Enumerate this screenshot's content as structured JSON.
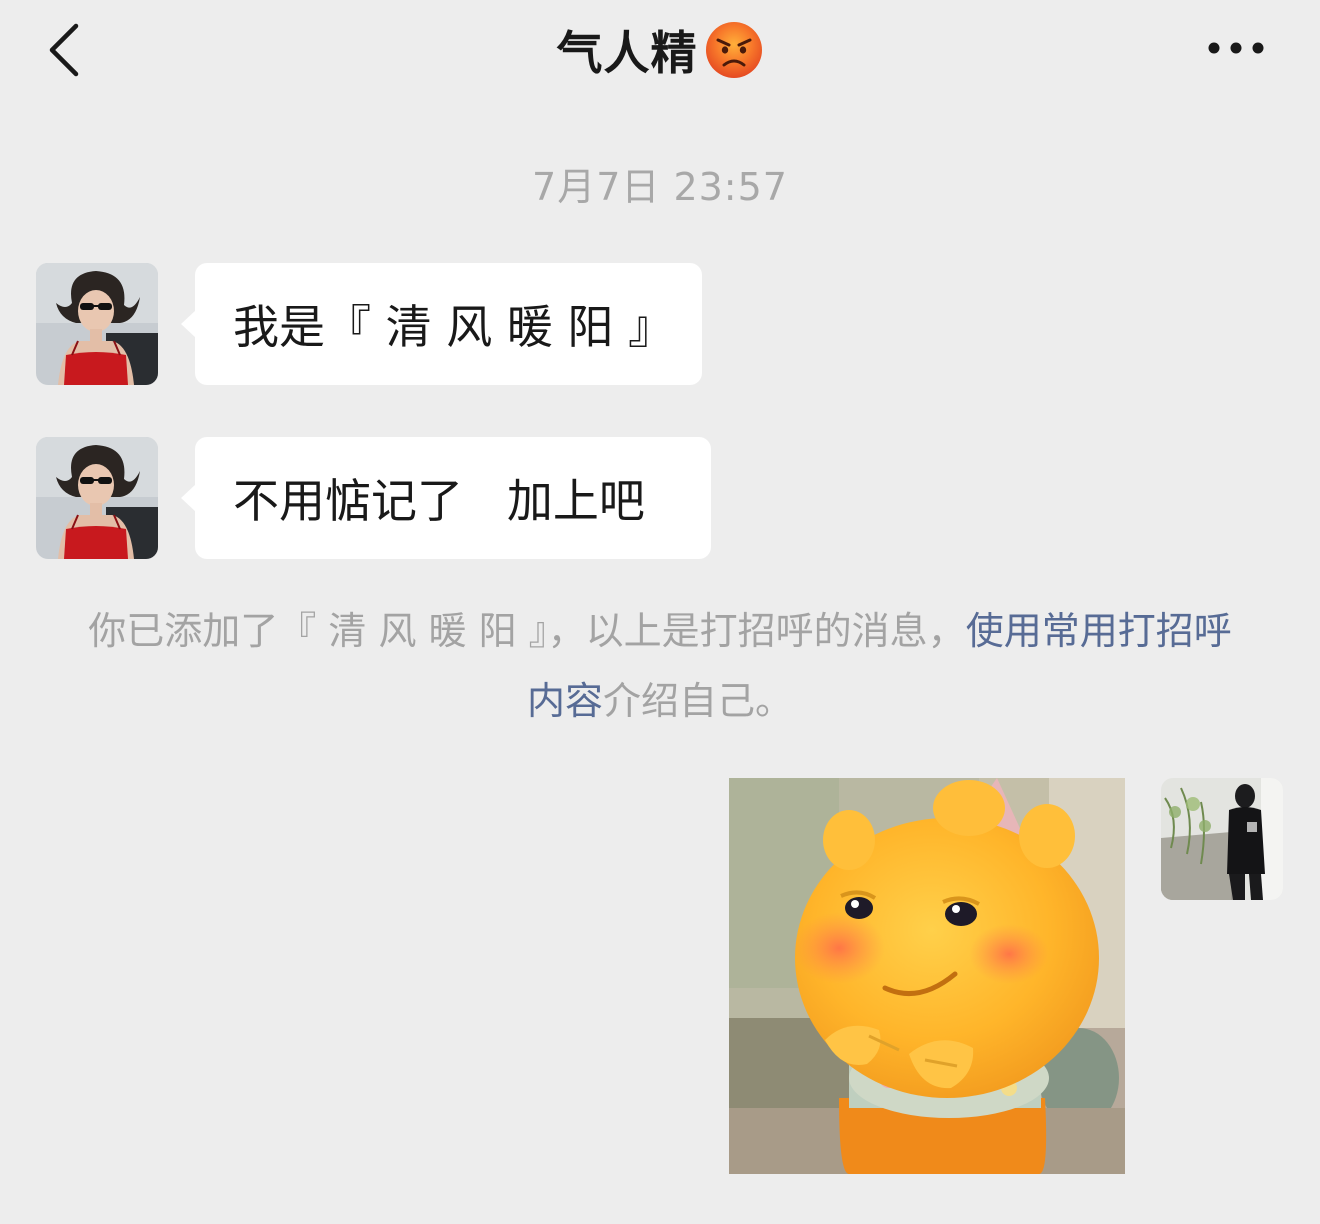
{
  "header": {
    "title": "气人精",
    "title_emoji": "angry-face-emoji",
    "back_icon": "chevron-left-icon",
    "more_icon": "more-dots-icon"
  },
  "timestamp": "7月7日 23:57",
  "messages": [
    {
      "sender": "contact",
      "type": "text",
      "text": "我是『 清 风 暖 阳 』"
    },
    {
      "sender": "contact",
      "type": "text",
      "text": "不用惦记了   加上吧"
    }
  ],
  "system_notice": {
    "prefix": "你已添加了『 清 风 暖 阳 』，以上是打招呼的消息，",
    "link": "使用常用打招呼内容",
    "suffix": "介绍自己。"
  },
  "sticker_message": {
    "sender": "self",
    "type": "sticker",
    "description_icon": "yellow-cartoon-sticker"
  },
  "colors": {
    "background": "#ededed",
    "bubble": "#ffffff",
    "link": "#576b95",
    "muted_text": "#a8a8a8",
    "text": "#191919"
  }
}
